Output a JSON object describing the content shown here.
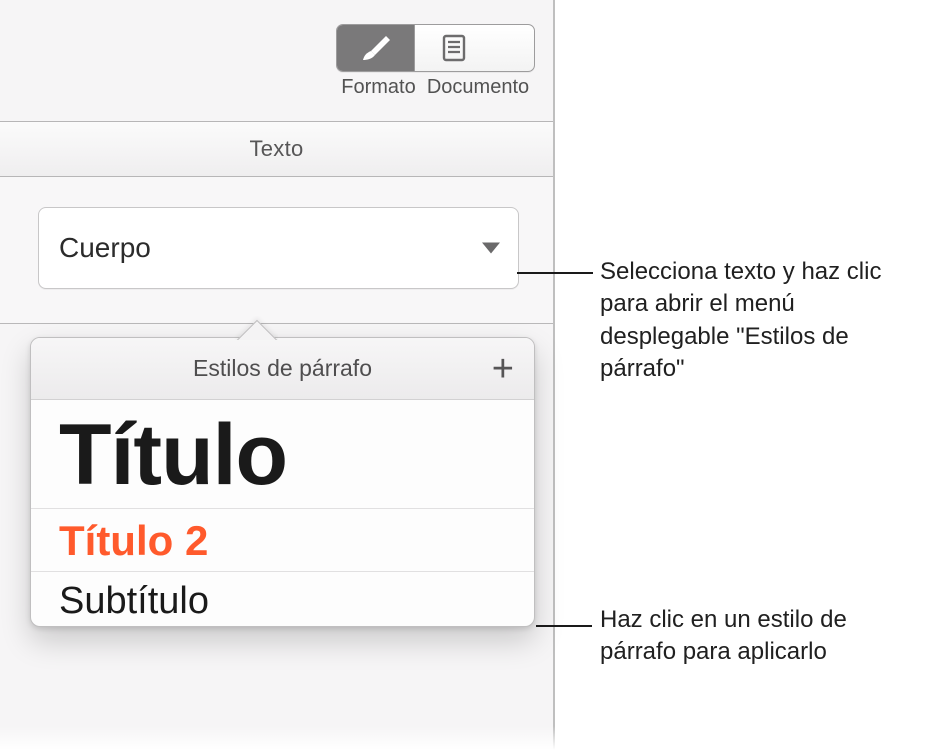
{
  "toolbar": {
    "format_label": "Formato",
    "document_label": "Documento",
    "active": "format"
  },
  "tabs": {
    "text_label": "Texto"
  },
  "style_picker": {
    "current_value": "Cuerpo"
  },
  "popover": {
    "title": "Estilos de párrafo",
    "add_icon": "plus-icon",
    "items": [
      {
        "label": "Título",
        "style_key": "titulo"
      },
      {
        "label": "Título 2",
        "style_key": "titulo2"
      },
      {
        "label": "Subtítulo",
        "style_key": "subtitulo"
      }
    ]
  },
  "callouts": {
    "c1": "Selecciona texto y haz clic para abrir el menú desplegable \"Estilos de párrafo\"",
    "c2": "Haz clic en un estilo de párrafo para aplicarlo"
  },
  "colors": {
    "accent_orange": "#ff5a2c",
    "panel_bg": "#f6f5f6",
    "divider": "#b7b6b7"
  }
}
